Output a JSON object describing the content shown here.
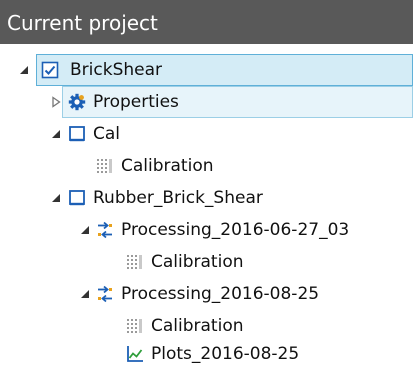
{
  "panel": {
    "title": "Current project"
  },
  "tree": {
    "root": {
      "label": "BrickShear",
      "icon": "project-checkbox-icon",
      "expanded": true,
      "selected": true
    },
    "properties": {
      "label": "Properties",
      "icon": "gear-icon",
      "expanded": false
    },
    "cal": {
      "label": "Cal",
      "icon": "folder-square-icon",
      "expanded": true,
      "calibration": {
        "label": "Calibration",
        "icon": "calibration-grid-icon"
      }
    },
    "rubber": {
      "label": "Rubber_Brick_Shear",
      "icon": "folder-square-icon",
      "expanded": true,
      "processing1": {
        "label": "Processing_2016-06-27_03",
        "icon": "processing-arrows-icon",
        "expanded": true,
        "calibration": {
          "label": "Calibration",
          "icon": "calibration-grid-icon"
        }
      },
      "processing2": {
        "label": "Processing_2016-08-25",
        "icon": "processing-arrows-icon",
        "expanded": true,
        "calibration": {
          "label": "Calibration",
          "icon": "calibration-grid-icon"
        },
        "plots": {
          "label": "Plots_2016-08-25",
          "icon": "line-chart-icon"
        }
      }
    }
  },
  "colors": {
    "header_bg": "#595959",
    "header_text": "#ffffff",
    "selection_bg": "#d4ecf6",
    "selection_border": "#5fb0d8",
    "hover_bg": "#e7f4fa",
    "accent_blue": "#1c5fb5"
  }
}
